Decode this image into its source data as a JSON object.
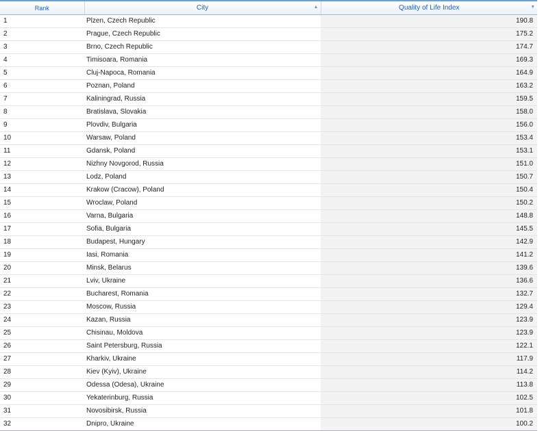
{
  "table": {
    "headers": {
      "rank": "Rank",
      "city": "City",
      "qli": "Quality of Life Index"
    },
    "sort_icons": {
      "city": "sort-up-icon",
      "qli": "sort-down-icon"
    },
    "rows": [
      {
        "rank": "1",
        "city": "Plzen, Czech Republic",
        "qli": "190.8"
      },
      {
        "rank": "2",
        "city": "Prague, Czech Republic",
        "qli": "175.2"
      },
      {
        "rank": "3",
        "city": "Brno, Czech Republic",
        "qli": "174.7"
      },
      {
        "rank": "4",
        "city": "Timisoara, Romania",
        "qli": "169.3"
      },
      {
        "rank": "5",
        "city": "Cluj-Napoca, Romania",
        "qli": "164.9"
      },
      {
        "rank": "6",
        "city": "Poznan, Poland",
        "qli": "163.2"
      },
      {
        "rank": "7",
        "city": "Kaliningrad, Russia",
        "qli": "159.5"
      },
      {
        "rank": "8",
        "city": "Bratislava, Slovakia",
        "qli": "158.0"
      },
      {
        "rank": "9",
        "city": "Plovdiv, Bulgaria",
        "qli": "156.0"
      },
      {
        "rank": "10",
        "city": "Warsaw, Poland",
        "qli": "153.4"
      },
      {
        "rank": "11",
        "city": "Gdansk, Poland",
        "qli": "153.1"
      },
      {
        "rank": "12",
        "city": "Nizhny Novgorod, Russia",
        "qli": "151.0"
      },
      {
        "rank": "13",
        "city": "Lodz, Poland",
        "qli": "150.7"
      },
      {
        "rank": "14",
        "city": "Krakow (Cracow), Poland",
        "qli": "150.4"
      },
      {
        "rank": "15",
        "city": "Wroclaw, Poland",
        "qli": "150.2"
      },
      {
        "rank": "16",
        "city": "Varna, Bulgaria",
        "qli": "148.8"
      },
      {
        "rank": "17",
        "city": "Sofia, Bulgaria",
        "qli": "145.5"
      },
      {
        "rank": "18",
        "city": "Budapest, Hungary",
        "qli": "142.9"
      },
      {
        "rank": "19",
        "city": "Iasi, Romania",
        "qli": "141.2"
      },
      {
        "rank": "20",
        "city": "Minsk, Belarus",
        "qli": "139.6"
      },
      {
        "rank": "21",
        "city": "Lviv, Ukraine",
        "qli": "136.6"
      },
      {
        "rank": "22",
        "city": "Bucharest, Romania",
        "qli": "132.7"
      },
      {
        "rank": "23",
        "city": "Moscow, Russia",
        "qli": "129.4"
      },
      {
        "rank": "24",
        "city": "Kazan, Russia",
        "qli": "123.9"
      },
      {
        "rank": "25",
        "city": "Chisinau, Moldova",
        "qli": "123.9"
      },
      {
        "rank": "26",
        "city": "Saint Petersburg, Russia",
        "qli": "122.1"
      },
      {
        "rank": "27",
        "city": "Kharkiv, Ukraine",
        "qli": "117.9"
      },
      {
        "rank": "28",
        "city": "Kiev (Kyiv), Ukraine",
        "qli": "114.2"
      },
      {
        "rank": "29",
        "city": "Odessa (Odesa), Ukraine",
        "qli": "113.8"
      },
      {
        "rank": "30",
        "city": "Yekaterinburg, Russia",
        "qli": "102.5"
      },
      {
        "rank": "31",
        "city": "Novosibirsk, Russia",
        "qli": "101.8"
      },
      {
        "rank": "32",
        "city": "Dnipro, Ukraine",
        "qli": "100.2"
      }
    ]
  }
}
